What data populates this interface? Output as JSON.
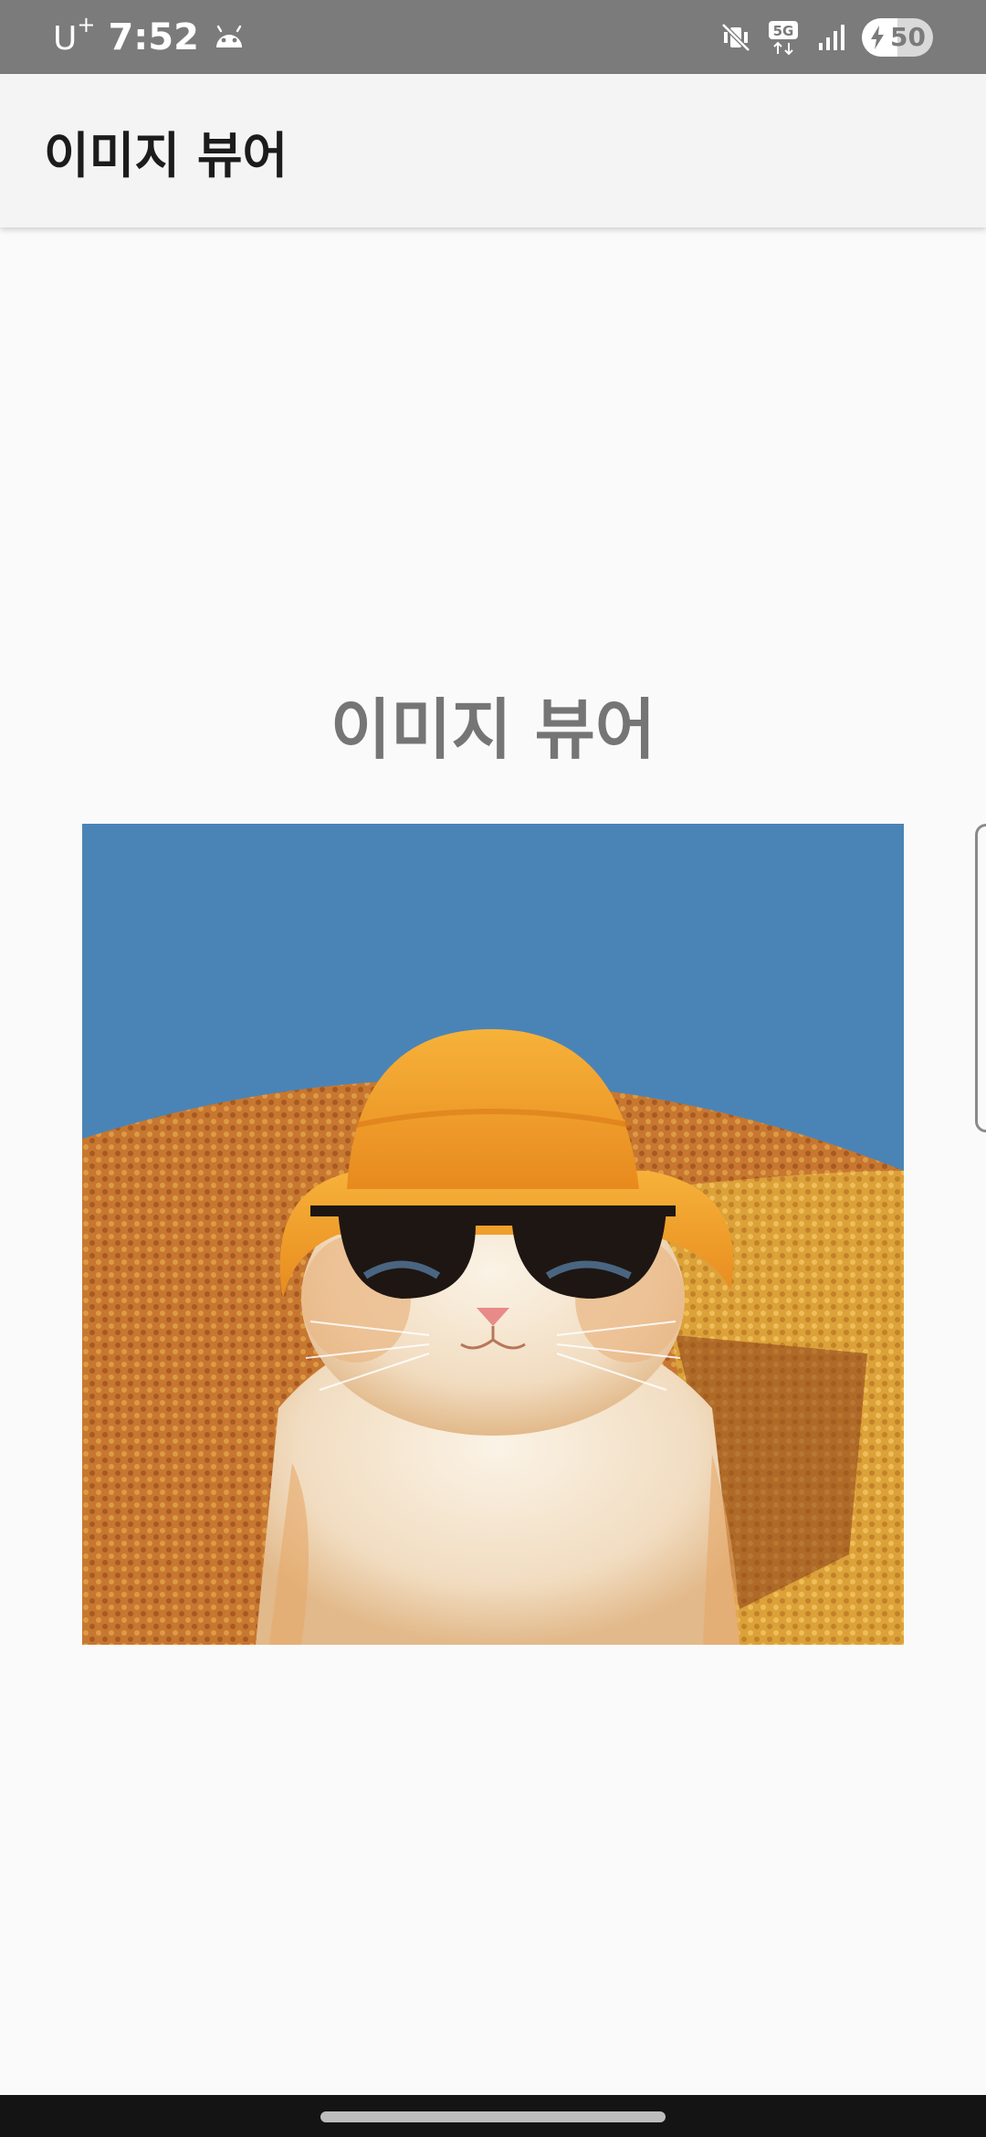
{
  "status_bar": {
    "carrier": "U",
    "carrier_sup": "+",
    "time": "7:52",
    "network": "5G",
    "battery_level": "50",
    "battery_fraction": 0.5,
    "icons": [
      "android-icon",
      "mute-icon",
      "5g-icon",
      "signal-icon",
      "battery-icon"
    ],
    "background_color": "#7b7b7b"
  },
  "app_bar": {
    "title": "이미지 뷰어"
  },
  "main": {
    "heading": "이미지 뷰어",
    "image": {
      "subject": "cat-wearing-orange-bucket-hat-and-sunglasses"
    }
  },
  "colors": {
    "background": "#fafafa",
    "app_bar": "#f4f4f4",
    "heading": "#757575",
    "sky": "#4a84b6",
    "hat": "#f0a22a"
  }
}
